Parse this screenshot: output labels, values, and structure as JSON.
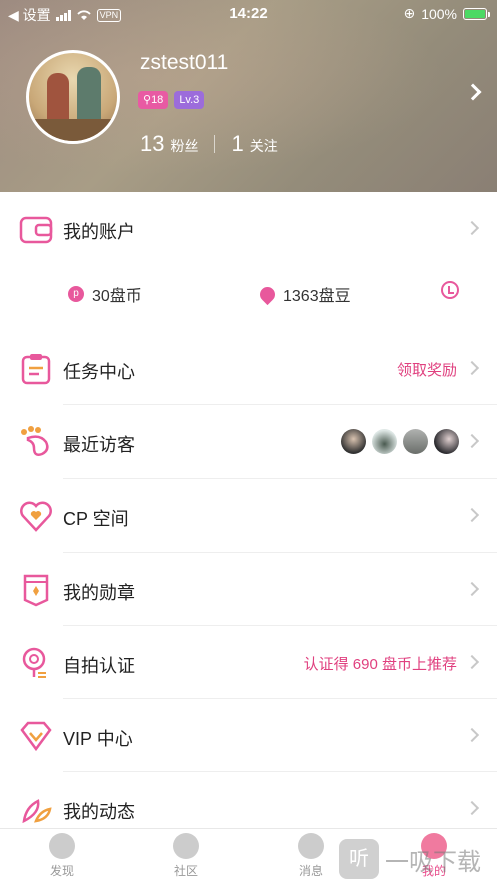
{
  "status_bar": {
    "back_label": "◀ 设置",
    "vpn": "VPN",
    "time": "14:22",
    "battery": "100%"
  },
  "profile": {
    "username": "zstest011",
    "badge_level": "18",
    "badge_lv": "Lv.3",
    "fans_count": "13",
    "fans_label": "粉丝",
    "follow_count": "1",
    "follow_label": "关注"
  },
  "account": {
    "title": "我的账户",
    "coins": "30盘币",
    "beans": "1363盘豆"
  },
  "menu": [
    {
      "title": "任务中心",
      "right": "领取奖励"
    },
    {
      "title": "最近访客",
      "right": ""
    },
    {
      "title": "CP 空间",
      "right": ""
    },
    {
      "title": "我的勋章",
      "right": ""
    },
    {
      "title": "自拍认证",
      "right": "认证得 690 盘币上推荐"
    },
    {
      "title": "VIP 中心",
      "right": ""
    },
    {
      "title": "我的动态",
      "right": ""
    }
  ],
  "tabs": [
    {
      "label": "发现"
    },
    {
      "label": "社区"
    },
    {
      "label": "消息"
    },
    {
      "label": "我的"
    }
  ],
  "watermark": {
    "text": "一吸下载",
    "icon_text": "听"
  },
  "colors": {
    "accent": "#e84a8a",
    "header": "#9c8a80"
  }
}
